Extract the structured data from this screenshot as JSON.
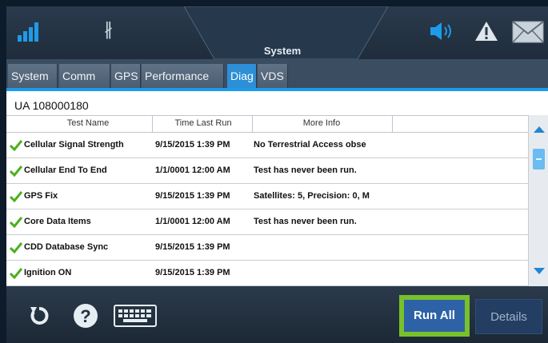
{
  "header": {
    "title": "System",
    "icons": [
      "signal-icon",
      "bluetooth-icon",
      "speaker-icon",
      "warning-icon",
      "mail-icon"
    ],
    "bluetooth_glyph": "∦"
  },
  "tabs": [
    {
      "label": "System",
      "active": false
    },
    {
      "label": "Comm",
      "active": false
    },
    {
      "label": "GPS",
      "active": false
    },
    {
      "label": "Performance",
      "active": false
    },
    {
      "label": "Diag",
      "active": true
    },
    {
      "label": "VDS",
      "active": false
    }
  ],
  "unit_label": "UA 108000180",
  "table": {
    "columns": [
      "Test Name",
      "Time Last Run",
      "More Info"
    ],
    "rows": [
      {
        "name": "Cellular Signal Strength",
        "time": "9/15/2015 1:39 PM",
        "info": "No Terrestrial Access obse",
        "status": "pass"
      },
      {
        "name": "Cellular End To End",
        "time": "1/1/0001 12:00 AM",
        "info": "Test has never been run.",
        "status": "pass"
      },
      {
        "name": "GPS Fix",
        "time": "9/15/2015 1:39 PM",
        "info": "Satellites: 5, Precision: 0, M",
        "status": "pass"
      },
      {
        "name": "Core Data Items",
        "time": "1/1/0001 12:00 AM",
        "info": "Test has never been run.",
        "status": "pass"
      },
      {
        "name": "CDD Database Sync",
        "time": "9/15/2015 1:39 PM",
        "info": "",
        "status": "pass"
      },
      {
        "name": "Ignition ON",
        "time": "9/15/2015 1:39 PM",
        "info": "",
        "status": "pass"
      }
    ]
  },
  "footer": {
    "icons": [
      "refresh-icon",
      "help-icon",
      "keyboard-icon"
    ],
    "run_all_label": "Run All",
    "details_label": "Details"
  },
  "colors": {
    "accent": "#1c9be6",
    "check": "#4caf1f",
    "highlight": "#78c12b",
    "button": "#2d63a6"
  }
}
